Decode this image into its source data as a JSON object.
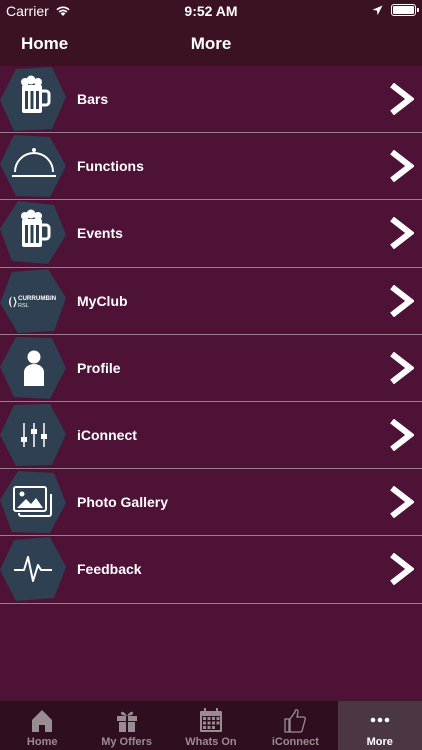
{
  "status": {
    "carrier": "Carrier",
    "time": "9:52 AM"
  },
  "nav": {
    "back_label": "Home",
    "title": "More"
  },
  "menu": {
    "items": [
      {
        "label": "Bars",
        "icon": "beer-mug-icon"
      },
      {
        "label": "Functions",
        "icon": "service-bell-icon"
      },
      {
        "label": "Events",
        "icon": "beer-mug-icon"
      },
      {
        "label": "MyClub",
        "icon": "currumbin-rsl-logo"
      },
      {
        "label": "Profile",
        "icon": "person-icon"
      },
      {
        "label": "iConnect",
        "icon": "sliders-icon"
      },
      {
        "label": "Photo Gallery",
        "icon": "photo-gallery-icon"
      },
      {
        "label": "Feedback",
        "icon": "pulse-icon"
      }
    ]
  },
  "logo_text": {
    "line1": "CURRUMBIN",
    "line2": "RSL"
  },
  "tabs": [
    {
      "label": "Home",
      "icon": "house-icon"
    },
    {
      "label": "My Offers",
      "icon": "gift-icon"
    },
    {
      "label": "Whats On",
      "icon": "calendar-icon"
    },
    {
      "label": "iConnect",
      "icon": "thumbs-up-icon"
    },
    {
      "label": "More",
      "icon": "more-dots-icon",
      "active": true
    }
  ],
  "colors": {
    "background": "#4e1237",
    "header": "#3a1224",
    "tabbar": "#2f0f1f",
    "tab_active": "#4b3744",
    "hex_icon": "#2e4052"
  }
}
